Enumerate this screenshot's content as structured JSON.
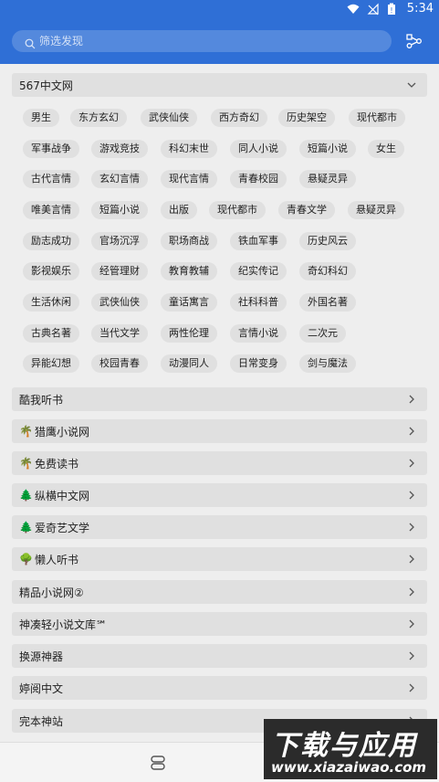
{
  "search": {
    "placeholder": "筛选发现"
  },
  "status": {
    "time": "5:34"
  },
  "colors": {
    "header": "#2f6fd6",
    "chip_bg": "#e0e0e0"
  },
  "group_567": {
    "title": "567中文网",
    "chips": [
      "男生",
      "东方玄幻",
      "武侠仙侠",
      "西方奇幻",
      "历史架空",
      "现代都市",
      "军事战争",
      "游戏竞技",
      "科幻末世",
      "同人小说",
      "短篇小说",
      "女生",
      "古代言情",
      "玄幻言情",
      "现代言情",
      "青春校园",
      "悬疑灵异",
      "唯美言情",
      "短篇小说",
      "出版",
      "现代都市",
      "青春文学",
      "悬疑灵异",
      "励志成功",
      "官场沉浮",
      "职场商战",
      "铁血军事",
      "历史风云",
      "影视娱乐",
      "经管理财",
      "教育教辅",
      "纪实传记",
      "奇幻科幻",
      "生活休闲",
      "武侠仙侠",
      "童话寓言",
      "社科科普",
      "外国名著",
      "古典名著",
      "当代文学",
      "两性伦理",
      "言情小说",
      "二次元",
      "异能幻想",
      "校园青春",
      "动漫同人",
      "日常变身",
      "剑与魔法"
    ]
  },
  "sources": [
    {
      "emoji": "",
      "label": "酷我听书"
    },
    {
      "emoji": "🌴",
      "label": "猎鹰小说网"
    },
    {
      "emoji": "🌴",
      "label": "免费读书"
    },
    {
      "emoji": "🌲",
      "label": "纵横中文网"
    },
    {
      "emoji": "🌲",
      "label": "爱奇艺文学"
    },
    {
      "emoji": "🌳",
      "label": "懒人听书"
    },
    {
      "emoji": "",
      "label": "精品小说网②"
    },
    {
      "emoji": "",
      "label": "神凑轻小说文库℠"
    },
    {
      "emoji": "",
      "label": "换源神器"
    },
    {
      "emoji": "",
      "label": "婷阅中文"
    },
    {
      "emoji": "",
      "label": "完本神站"
    }
  ],
  "watermark": {
    "title": "下载与应用",
    "url": "www.xiazaiwao.com"
  }
}
